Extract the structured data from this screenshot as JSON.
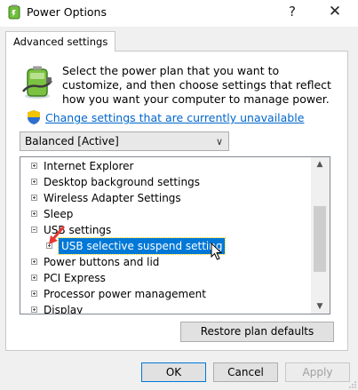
{
  "window": {
    "title": "Power Options",
    "help_label": "?",
    "close_label": "✕"
  },
  "tab": {
    "label": "Advanced settings"
  },
  "description": "Select the power plan that you want to customize, and then choose settings that reflect how you want your computer to manage power.",
  "change_link": "Change settings that are currently unavailable",
  "plan_select": {
    "value": "Balanced [Active]"
  },
  "tree": {
    "items": [
      {
        "label": "Internet Explorer",
        "expanded": false,
        "indent": 0
      },
      {
        "label": "Desktop background settings",
        "expanded": false,
        "indent": 0
      },
      {
        "label": "Wireless Adapter Settings",
        "expanded": false,
        "indent": 0
      },
      {
        "label": "Sleep",
        "expanded": false,
        "indent": 0
      },
      {
        "label": "USB settings",
        "expanded": true,
        "indent": 0
      },
      {
        "label": "USB selective suspend setting",
        "expanded": false,
        "indent": 1,
        "selected": true
      },
      {
        "label": "Power buttons and lid",
        "expanded": false,
        "indent": 0
      },
      {
        "label": "PCI Express",
        "expanded": false,
        "indent": 0
      },
      {
        "label": "Processor power management",
        "expanded": false,
        "indent": 0
      },
      {
        "label": "Display",
        "expanded": false,
        "indent": 0
      }
    ]
  },
  "buttons": {
    "restore": "Restore plan defaults",
    "ok": "OK",
    "cancel": "Cancel",
    "apply": "Apply"
  },
  "colors": {
    "selection": "#0078d7",
    "link": "#0066cc",
    "annotation_arrow": "#e53935"
  }
}
